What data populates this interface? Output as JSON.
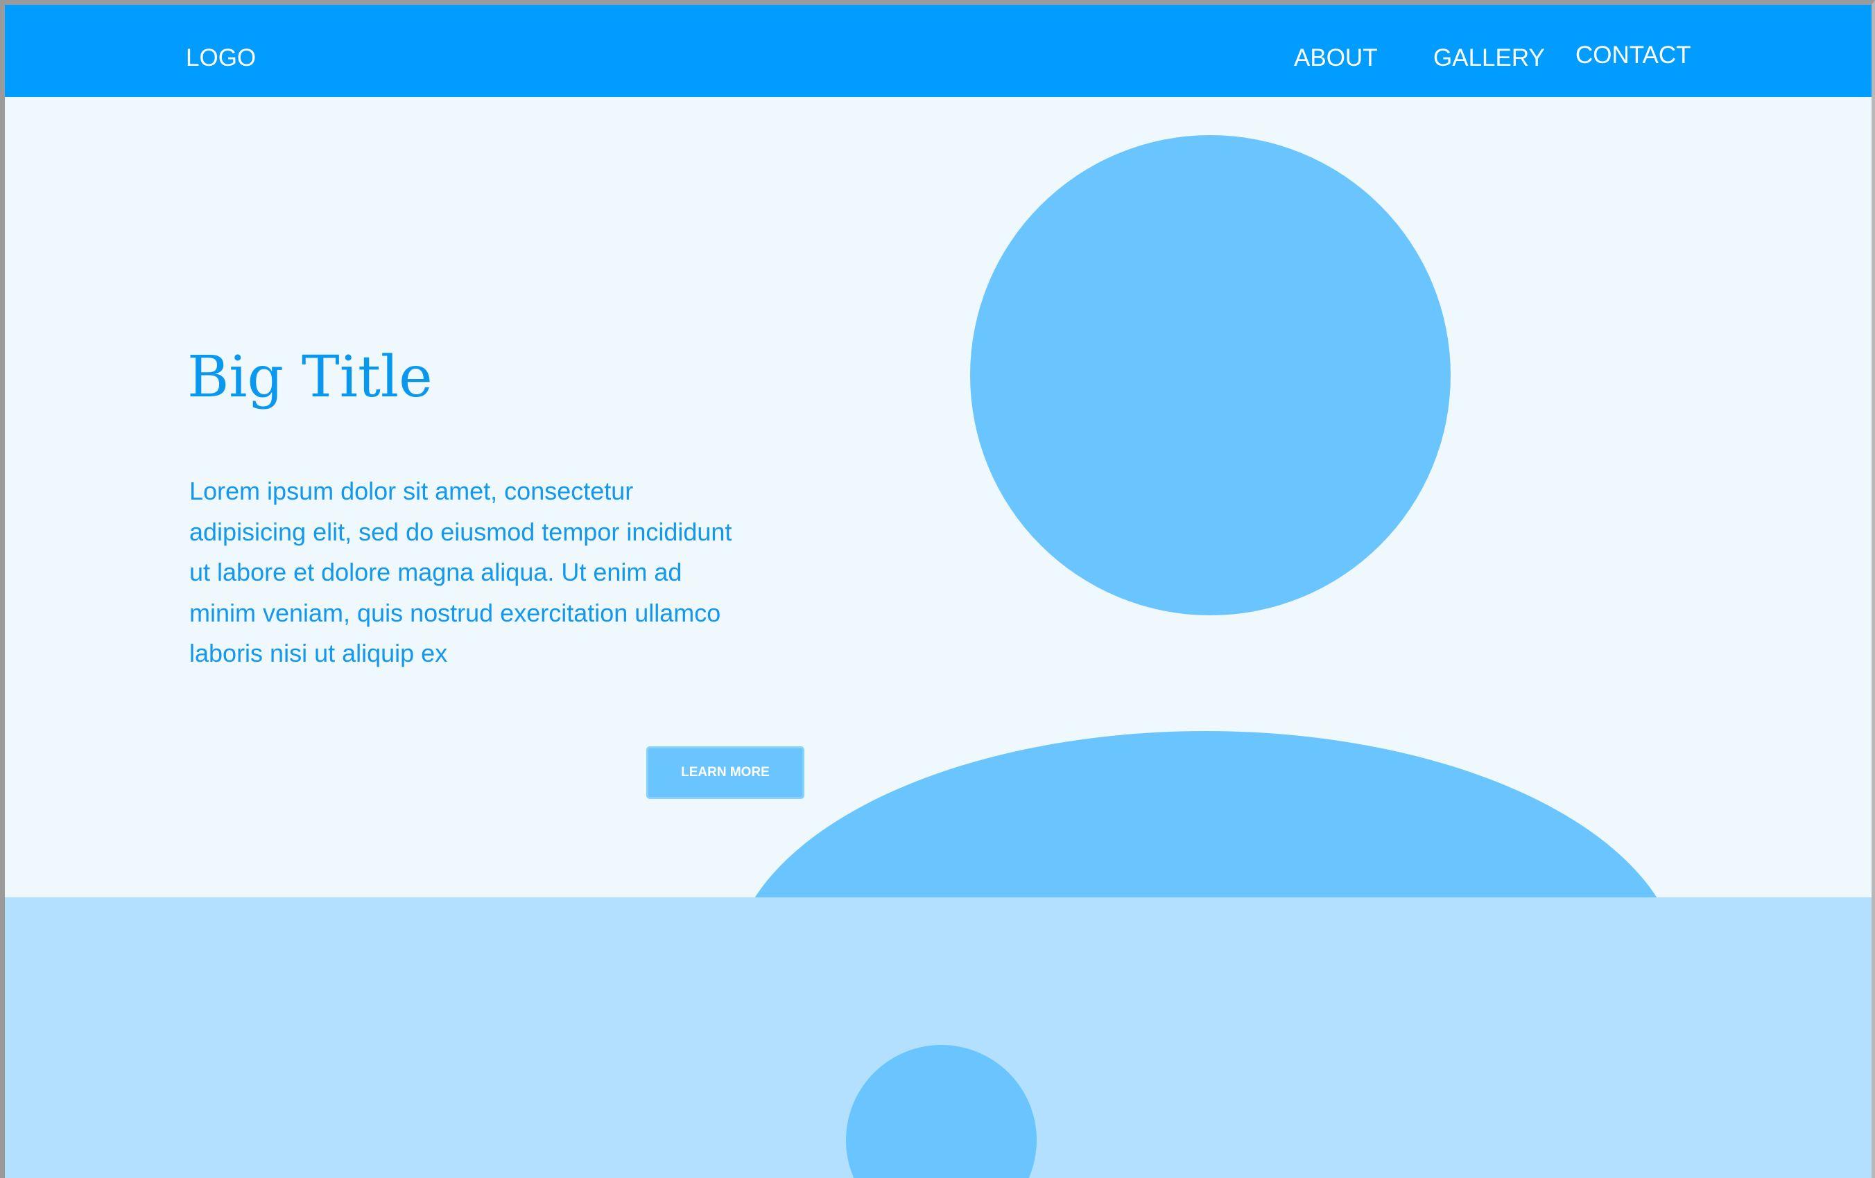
{
  "navbar": {
    "logo": "LOGO",
    "links": [
      "ABOUT",
      "GALLERY",
      "CONTACT"
    ]
  },
  "hero": {
    "title": "Big Title",
    "body": "Lorem ipsum dolor sit amet, consectetur adipisicing elit, sed do eiusmod tempor incididunt ut labore et dolore magna aliqua. Ut enim ad minim veniam, quis nostrud exercitation ullamco laboris nisi ut aliquip ex",
    "button_label": "LEARN MORE"
  },
  "colors": {
    "nav_bg": "#009cff",
    "hero_bg": "#eef8fd",
    "placeholder_shape": "#6ac5ff",
    "bottom_bg": "#b3e0ff",
    "text_accent": "#0a98ee"
  }
}
